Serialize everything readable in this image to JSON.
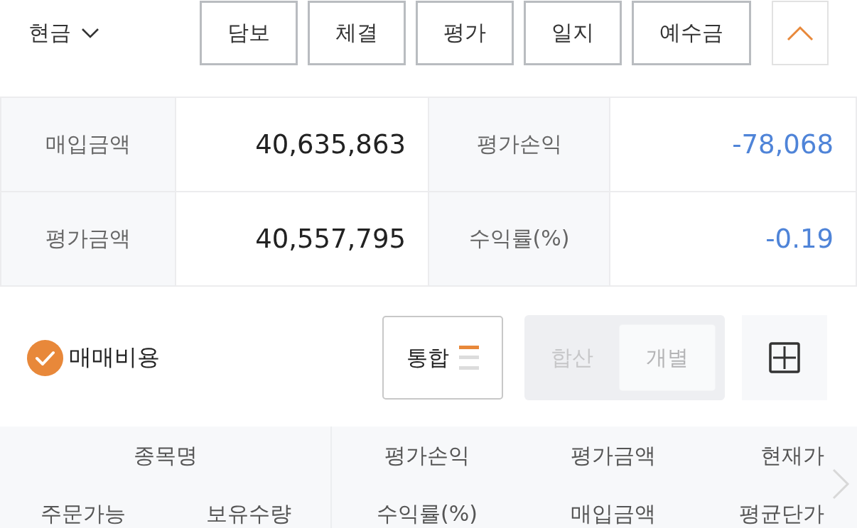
{
  "account_selector": {
    "label": "현금",
    "expanded": false
  },
  "buttons": [
    {
      "label": "담보"
    },
    {
      "label": "체결"
    },
    {
      "label": "평가"
    },
    {
      "label": "일지"
    },
    {
      "label": "예수금"
    }
  ],
  "panel_toggle": {
    "expanded": true
  },
  "summary": {
    "rows": [
      [
        {
          "label": "매입금액",
          "value": "40,635,863",
          "kind": "neutral"
        },
        {
          "label": "평가손익",
          "value": "-78,068",
          "kind": "negative"
        }
      ],
      [
        {
          "label": "평가금액",
          "value": "40,557,795",
          "kind": "neutral"
        },
        {
          "label": "수익률(%)",
          "value": "-0.19",
          "kind": "negative"
        }
      ]
    ]
  },
  "options": {
    "fee_toggle": {
      "label": "매매비용",
      "checked": true
    },
    "view_button": {
      "label": "통합"
    },
    "mode": [
      {
        "label": "합산",
        "selected": false
      },
      {
        "label": "개별",
        "selected": true
      }
    ]
  },
  "table_header": {
    "left": {
      "title": "종목명",
      "sub": [
        "주문가능",
        "보유수량"
      ]
    },
    "columns": [
      {
        "top": "평가손익",
        "bottom": "수익률(%)"
      },
      {
        "top": "평가금액",
        "bottom": "매입금액"
      },
      {
        "top": "현재가",
        "bottom": "평균단가"
      }
    ]
  }
}
